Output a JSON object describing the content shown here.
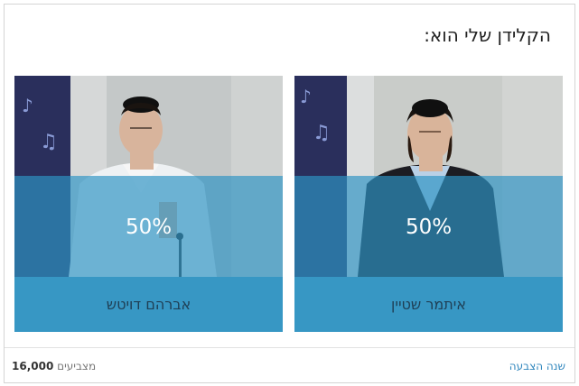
{
  "poll": {
    "question": "הקלידן שלי הוא:",
    "options": [
      {
        "name": "איתמר שטיין",
        "percent_label": "50%",
        "percent": 50,
        "photo_icon": "person-photo"
      },
      {
        "name": "אברהם דויטש",
        "percent_label": "50%",
        "percent": 50,
        "photo_icon": "person-photo"
      }
    ]
  },
  "footer": {
    "change_vote_label": "שנה הצבעה",
    "voters_count": "16,000",
    "voters_label": "מצביעים"
  },
  "colors": {
    "accent": "#3797c4",
    "overlay": "#2e94c4",
    "link": "#2f86bd",
    "name_text": "#1f3f55"
  }
}
